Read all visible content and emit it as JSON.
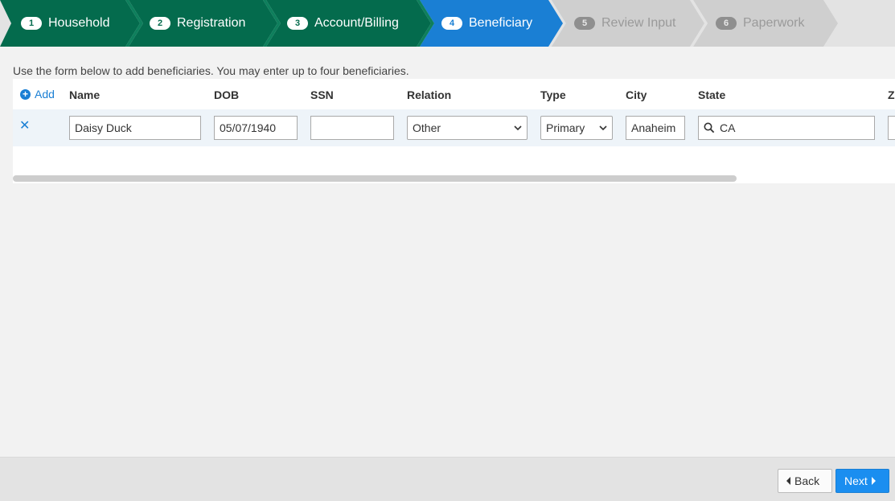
{
  "steps": [
    {
      "number": "1",
      "label": "Household",
      "status": "done"
    },
    {
      "number": "2",
      "label": "Registration",
      "status": "done"
    },
    {
      "number": "3",
      "label": "Account/Billing",
      "status": "done"
    },
    {
      "number": "4",
      "label": "Beneficiary",
      "status": "active"
    },
    {
      "number": "5",
      "label": "Review Input",
      "status": "todo"
    },
    {
      "number": "6",
      "label": "Paperwork",
      "status": "todo"
    }
  ],
  "intro_text": "Use the form below to add beneficiaries. You may enter up to four beneficiaries.",
  "table": {
    "add_label": "Add",
    "columns": [
      "Name",
      "DOB",
      "SSN",
      "Relation",
      "Type",
      "City",
      "State",
      "Z"
    ],
    "rows": [
      {
        "name": "Daisy Duck",
        "dob": "05/07/1940",
        "ssn": "",
        "relation": "Other",
        "type": "Primary",
        "city": "Anaheim",
        "state": "CA"
      }
    ]
  },
  "footer": {
    "back_label": "Back",
    "next_label": "Next"
  },
  "colors": {
    "done": "#046b4d",
    "active": "#1a7fd4",
    "todo": "#cfcfcf",
    "link": "#1a7fd4",
    "primary_button": "#1a8ef0"
  },
  "icons": {
    "add": "plus-circle-icon",
    "remove": "close-icon",
    "state_search": "search-icon",
    "select": "chevron-down-icon",
    "back": "caret-left-icon",
    "next": "caret-right-icon"
  }
}
